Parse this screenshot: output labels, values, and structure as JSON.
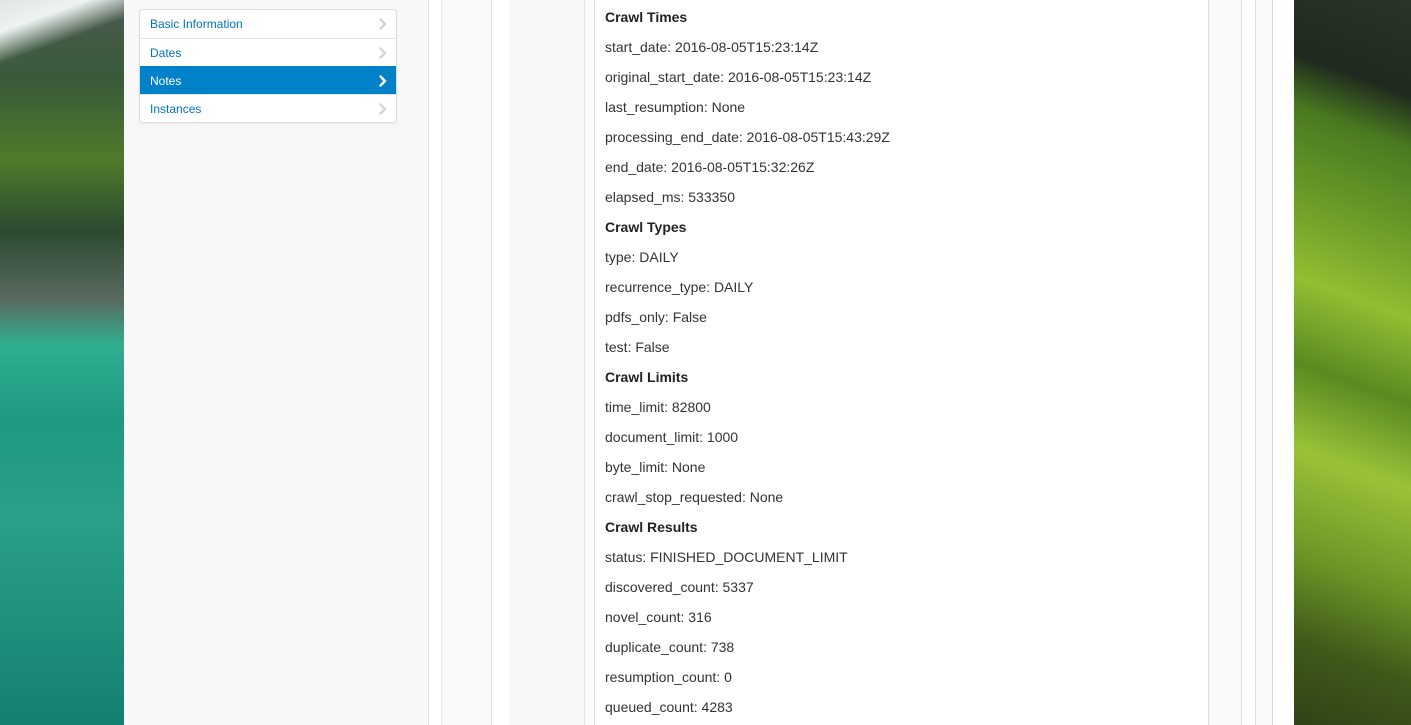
{
  "sidebar": {
    "items": [
      {
        "label": "Basic Information",
        "active": false
      },
      {
        "label": "Dates",
        "active": false
      },
      {
        "label": "Notes",
        "active": true
      },
      {
        "label": "Instances",
        "active": false
      }
    ]
  },
  "content": {
    "lines": [
      {
        "text": "Crawl Times",
        "heading": true
      },
      {
        "text": "start_date: 2016-08-05T15:23:14Z",
        "heading": false
      },
      {
        "text": "original_start_date: 2016-08-05T15:23:14Z",
        "heading": false
      },
      {
        "text": "last_resumption: None",
        "heading": false
      },
      {
        "text": "processing_end_date: 2016-08-05T15:43:29Z",
        "heading": false
      },
      {
        "text": "end_date: 2016-08-05T15:32:26Z",
        "heading": false
      },
      {
        "text": "elapsed_ms: 533350",
        "heading": false
      },
      {
        "text": "Crawl Types",
        "heading": true
      },
      {
        "text": "type: DAILY",
        "heading": false
      },
      {
        "text": "recurrence_type: DAILY",
        "heading": false
      },
      {
        "text": "pdfs_only: False",
        "heading": false
      },
      {
        "text": "test: False",
        "heading": false
      },
      {
        "text": "Crawl Limits",
        "heading": true
      },
      {
        "text": "time_limit: 82800",
        "heading": false
      },
      {
        "text": "document_limit: 1000",
        "heading": false
      },
      {
        "text": "byte_limit: None",
        "heading": false
      },
      {
        "text": "crawl_stop_requested: None",
        "heading": false
      },
      {
        "text": "Crawl Results",
        "heading": true
      },
      {
        "text": "status: FINISHED_DOCUMENT_LIMIT",
        "heading": false
      },
      {
        "text": "discovered_count: 5337",
        "heading": false
      },
      {
        "text": "novel_count: 316",
        "heading": false
      },
      {
        "text": "duplicate_count: 738",
        "heading": false
      },
      {
        "text": "resumption_count: 0",
        "heading": false
      },
      {
        "text": "queued_count: 4283",
        "heading": false
      }
    ]
  },
  "colors": {
    "nav_active_bg": "#0081c8",
    "nav_link": "#0073c0"
  },
  "icons": {
    "nav_chevron": "chevron-right-icon"
  }
}
